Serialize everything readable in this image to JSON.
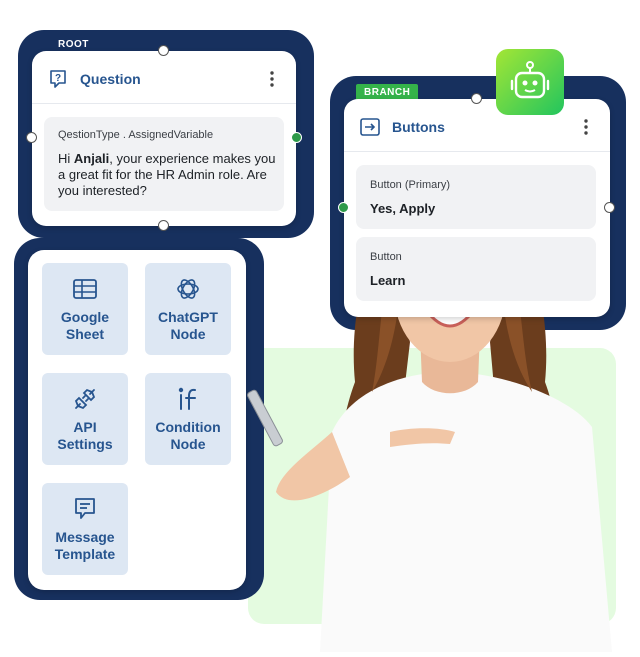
{
  "question_card": {
    "tag": "ROOT",
    "title": "Question",
    "meta": "QestionType .  AssignedVariable",
    "message_prefix": "Hi ",
    "message_name": "Anjali",
    "message_rest": ", your experience makes you a great fit for the HR Admin role. Are you interested?"
  },
  "buttons_card": {
    "tag": "BRANCH",
    "title": "Buttons",
    "options": [
      {
        "label": "Button (Primary)",
        "value": "Yes, Apply"
      },
      {
        "label": "Button",
        "value": "Learn"
      }
    ]
  },
  "node_palette": [
    {
      "icon": "table-icon",
      "line1": "Google",
      "line2": "Sheet"
    },
    {
      "icon": "openai-icon",
      "line1": "ChatGPT",
      "line2": "Node"
    },
    {
      "icon": "plug-icon",
      "line1": "API",
      "line2": "Settings"
    },
    {
      "icon": "if-icon",
      "line1": "Condition",
      "line2": "Node"
    },
    {
      "icon": "message-template-icon",
      "line1": "Message",
      "line2": "Template"
    }
  ],
  "colors": {
    "navy": "#17305e",
    "accent_blue": "#27558f",
    "tile_bg": "#dde7f3",
    "branch_green": "#35b34a",
    "bot_gradient_start": "#a3e635",
    "bot_gradient_end": "#22c55e",
    "photo_bg": "#e4fbe0"
  }
}
